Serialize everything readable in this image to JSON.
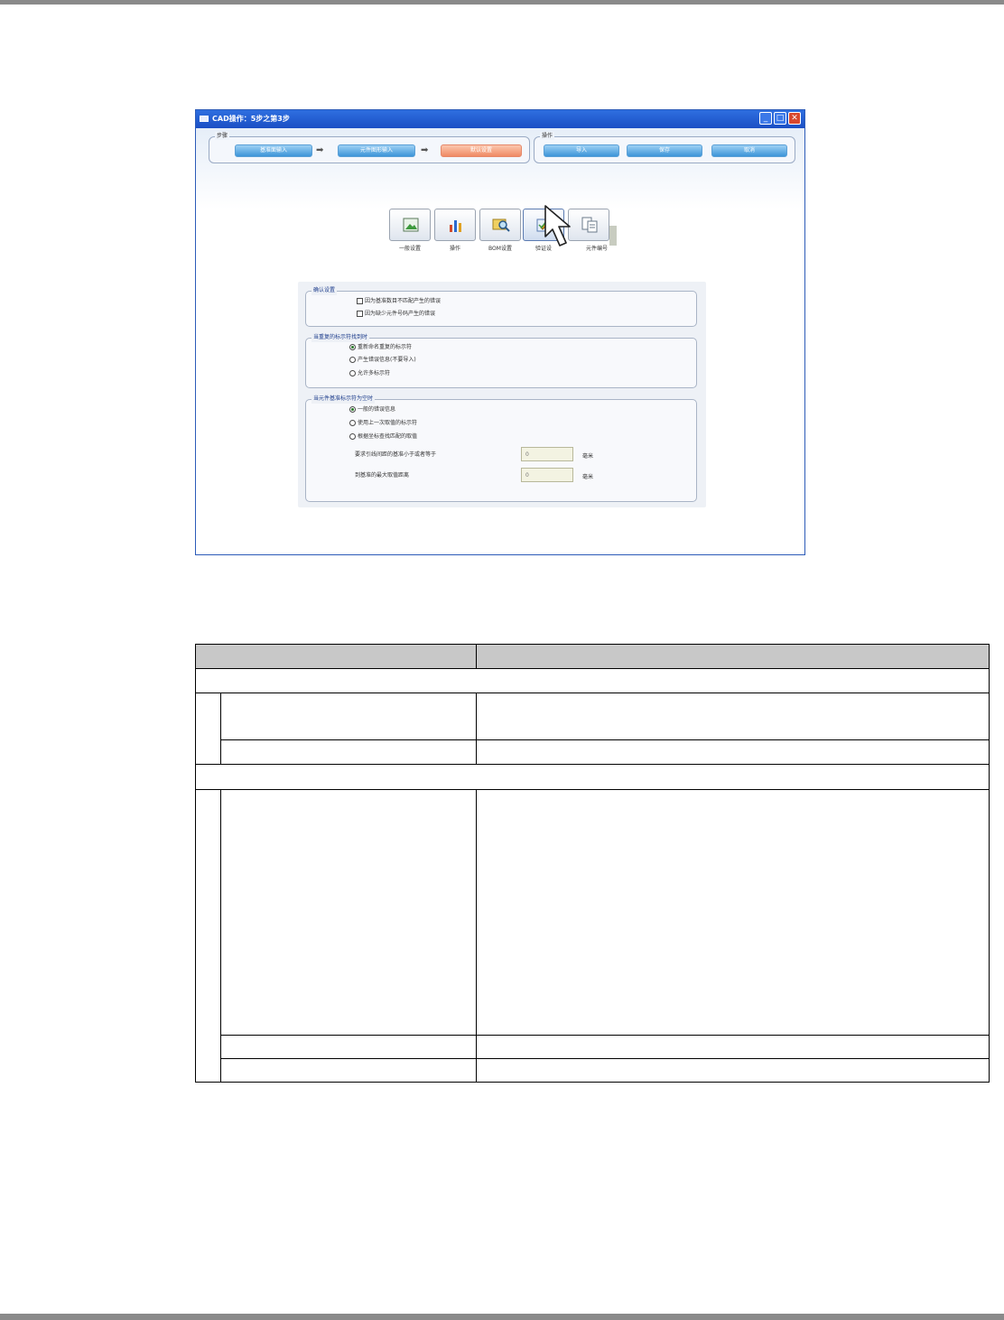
{
  "window": {
    "title": "CAD操作：5步之第3步",
    "min_icon": "minimize-icon",
    "max_icon": "maximize-icon",
    "close_icon": "close-icon"
  },
  "steps_group": {
    "legend": "步骤",
    "steps": [
      {
        "label": "基准面输入",
        "active": false
      },
      {
        "label": "元件图形输入",
        "active": false
      },
      {
        "label": "默认设置",
        "active": true
      }
    ]
  },
  "ops_group": {
    "legend": "操作",
    "buttons": [
      "导入",
      "保存",
      "取消"
    ]
  },
  "toolbar": [
    {
      "label": "一般设置",
      "icon": "image-icon"
    },
    {
      "label": "操作",
      "icon": "bar-chart-icon"
    },
    {
      "label": "BOM设置",
      "icon": "magnifier-icon"
    },
    {
      "label": "验证设",
      "icon": "edit-check-icon"
    },
    {
      "label": "元件编号",
      "icon": "component-id-icon"
    }
  ],
  "settings": {
    "confirm": {
      "legend": "确认设置",
      "options": [
        {
          "label": "因为基准数目不匹配产生的错误",
          "checked": false
        },
        {
          "label": "因为缺少元件号码产生的错误",
          "checked": false
        }
      ]
    },
    "duplicate": {
      "legend": "当重复的标示符找到时",
      "options": [
        {
          "label": "重新命名重复的标示符",
          "selected": true
        },
        {
          "label": "产生错误信息(不要导入)",
          "selected": false
        },
        {
          "label": "允许多标示符",
          "selected": false
        }
      ]
    },
    "empty_ref": {
      "legend": "当元件基准标示符为空时",
      "options": [
        {
          "label": "一般的错误信息",
          "selected": true
        },
        {
          "label": "使用上一次取值的标示符",
          "selected": false
        },
        {
          "label": "根据坐标查找匹配的取值",
          "selected": false
        }
      ],
      "fields": [
        {
          "label": "要求引线间距的基准小于或者等于",
          "value": "0",
          "unit": "毫米"
        },
        {
          "label": "到基准的最大取值距离",
          "value": "0",
          "unit": "毫米"
        }
      ]
    }
  }
}
